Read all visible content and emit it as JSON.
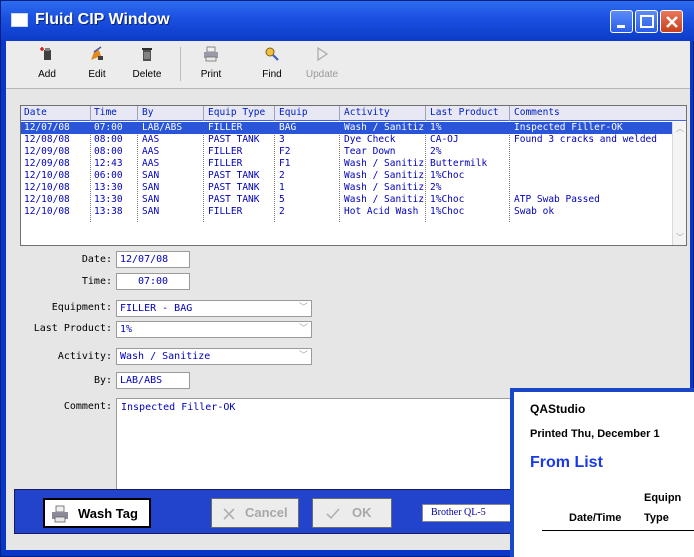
{
  "window": {
    "title": "Fluid CIP Window"
  },
  "toolbar": {
    "buttons": [
      {
        "label": "Add",
        "icon": "add-icon",
        "enabled": true
      },
      {
        "label": "Edit",
        "icon": "edit-icon",
        "enabled": true
      },
      {
        "label": "Delete",
        "icon": "trash-icon",
        "enabled": true
      },
      {
        "label": "Print",
        "icon": "printer-icon",
        "enabled": true
      },
      {
        "label": "Find",
        "icon": "find-icon",
        "enabled": true
      },
      {
        "label": "Update",
        "icon": "play-icon",
        "enabled": false
      }
    ]
  },
  "grid": {
    "columns": [
      "Date",
      "Time",
      "By",
      "Equip Type",
      "Equip",
      "Activity",
      "Last Product",
      "Comments"
    ],
    "rows": [
      [
        "12/07/08",
        "07:00",
        "LAB/ABS",
        "FILLER",
        "BAG",
        "Wash / Sanitize",
        "1%",
        "Inspected Filler-OK"
      ],
      [
        "12/08/08",
        "08:00",
        "AAS",
        "PAST TANK",
        "3",
        "Dye Check",
        "CA-OJ",
        "Found 3 cracks and welded"
      ],
      [
        "12/09/08",
        "08:00",
        "AAS",
        "FILLER",
        "F2",
        "Tear Down",
        "2%",
        ""
      ],
      [
        "12/09/08",
        "12:43",
        "AAS",
        "FILLER",
        "F1",
        "Wash / Sanitize",
        "Buttermilk",
        ""
      ],
      [
        "12/10/08",
        "06:00",
        "SAN",
        "PAST TANK",
        "2",
        "Wash / Sanitize",
        "1%Choc",
        ""
      ],
      [
        "12/10/08",
        "13:30",
        "SAN",
        "PAST TANK",
        "1",
        "Wash / Sanitize",
        "2%",
        ""
      ],
      [
        "12/10/08",
        "13:30",
        "SAN",
        "PAST TANK",
        "5",
        "Wash / Sanitize",
        "1%Choc",
        "ATP Swab Passed"
      ],
      [
        "12/10/08",
        "13:38",
        "SAN",
        "FILLER",
        "2",
        "Hot Acid Wash",
        "1%Choc",
        "Swab ok"
      ]
    ],
    "selected_row": 0
  },
  "form": {
    "date_label": "Date:",
    "date_value": "12/07/08",
    "time_label": "Time:",
    "time_value": "07:00",
    "equipment_label": "Equipment:",
    "equipment_value": "FILLER - BAG",
    "last_product_label": "Last Product:",
    "last_product_value": "1%",
    "activity_label": "Activity:",
    "activity_value": "Wash / Sanitize",
    "by_label": "By:",
    "by_value": "LAB/ABS",
    "comment_label": "Comment:",
    "comment_value": "Inspected Filler-OK"
  },
  "bottom": {
    "wash_tag_label": "Wash Tag",
    "cancel_label": "Cancel",
    "ok_label": "OK",
    "printer_value": "Brother QL-5"
  },
  "report": {
    "app_name": "QAStudio",
    "printed_text": "Printed Thu, December 1",
    "from_list": "From List",
    "equip_header": "Equipn",
    "datetime_header": "Date/Time",
    "type_header": "Type"
  },
  "colors": {
    "title_bar": "#1a4fe0",
    "selection": "#2a55d8",
    "grid_text": "#0000c0",
    "bottom_bar": "#2244cc",
    "report_heading": "#1a3ae8"
  }
}
